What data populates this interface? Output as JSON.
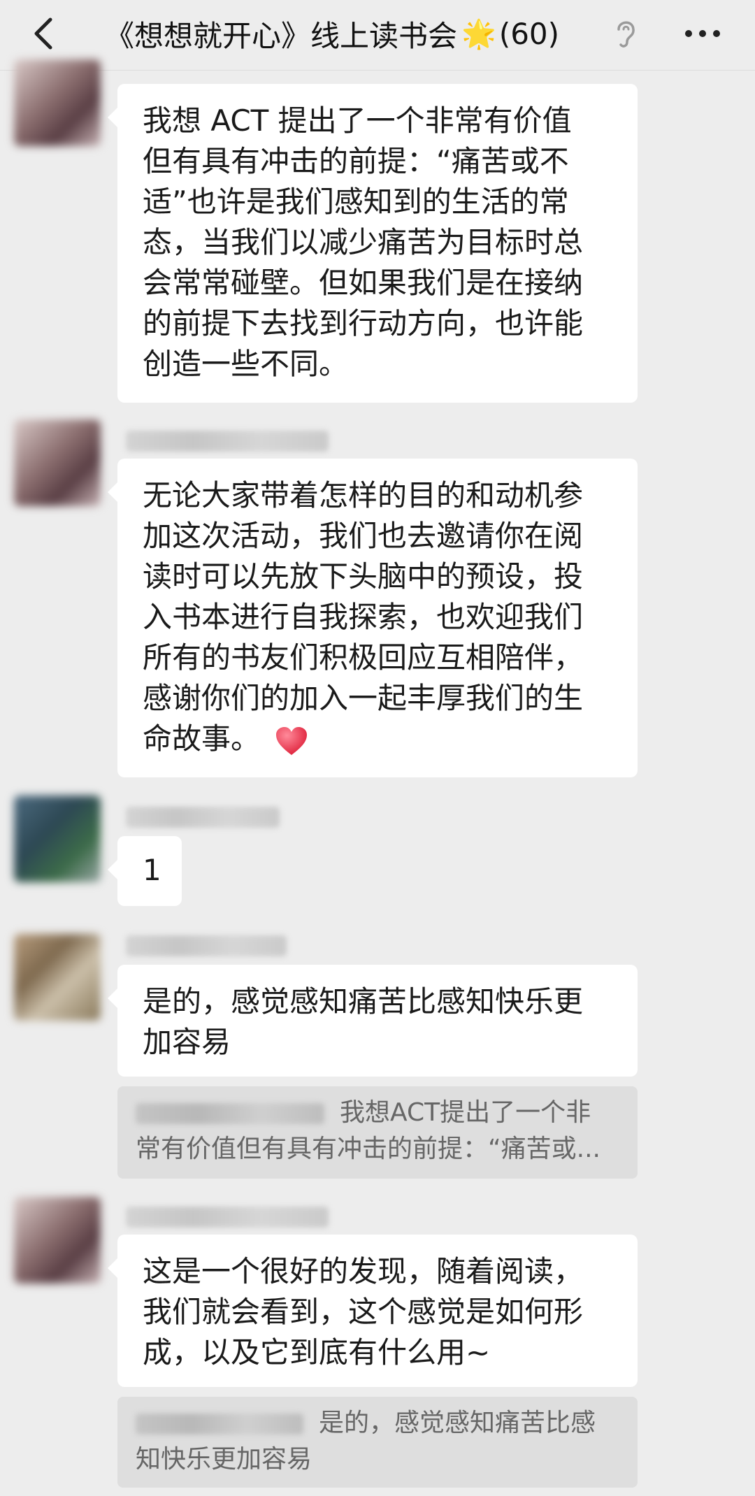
{
  "header": {
    "title": "《想想就开心》线上读书会",
    "star_icon": "🌟",
    "member_count": "(60)"
  },
  "messages": [
    {
      "text": "我想 ACT 提出了一个非常有价值\n但有具有冲击的前提：“痛苦或不\n适”也许是我们感知到的生活的常\n态，当我们以减少痛苦为目标时总\n会常常碰壁。但如果我们是在接纳\n的前提下去找到行动方向，也许能\n创造一些不同。"
    },
    {
      "text": "无论大家带着怎样的目的和动机参\n加这次活动，我们也去邀请你在阅\n读时可以先放下头脑中的预设，投\n入书本进行自我探索，也欢迎我们\n所有的书友们积极回应互相陪伴，\n感谢你们的加入一起丰厚我们的生\n命故事。",
      "emoji": "heart-icon"
    },
    {
      "text": "1"
    },
    {
      "text": "是的，感觉感知痛苦比感知快乐更\n加容易",
      "quote": "我想ACT提出了一个非\n常有价值但有具有冲击的前提：“痛苦或..."
    },
    {
      "text": "这是一个很好的发现，随着阅读，\n我们就会看到，这个感觉是如何形\n成，以及它到底有什么用~",
      "quote": "是的，感觉感知痛苦比感\n知快乐更加容易"
    }
  ],
  "colors": {
    "background": "#ededed",
    "bubble": "#ffffff",
    "quote_bg": "#dedede",
    "heart": "#e8334a"
  }
}
